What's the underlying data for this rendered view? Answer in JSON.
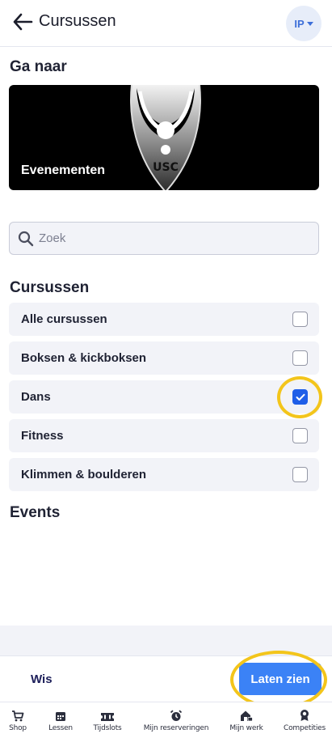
{
  "header": {
    "title": "Cursussen",
    "avatar_initials": "IP"
  },
  "goto": {
    "heading": "Ga naar",
    "banner_label": "Evenementen",
    "logo_text": "USC"
  },
  "search": {
    "placeholder": "Zoek",
    "value": ""
  },
  "courses": {
    "heading": "Cursussen",
    "items": [
      {
        "label": "Alle cursussen",
        "checked": false
      },
      {
        "label": "Boksen & kickboksen",
        "checked": false
      },
      {
        "label": "Dans",
        "checked": true
      },
      {
        "label": "Fitness",
        "checked": false
      },
      {
        "label": "Klimmen & boulderen",
        "checked": false
      }
    ]
  },
  "events": {
    "heading": "Events"
  },
  "actions": {
    "clear_label": "Wis",
    "show_label": "Laten zien"
  },
  "tabbar": {
    "items": [
      {
        "label": "Shop",
        "icon": "cart-icon"
      },
      {
        "label": "Lessen",
        "icon": "calendar-icon"
      },
      {
        "label": "Tijdslots",
        "icon": "ticket-icon"
      },
      {
        "label": "Mijn reserveringen",
        "icon": "alarm-clock-icon"
      },
      {
        "label": "Mijn werk",
        "icon": "home-work-icon"
      },
      {
        "label": "Competities",
        "icon": "award-icon"
      }
    ]
  },
  "colors": {
    "accent": "#3b82f6",
    "checkbox_checked": "#1f5ee8",
    "highlight_ring": "#f3c51b",
    "row_bg": "#f2f3f8"
  }
}
